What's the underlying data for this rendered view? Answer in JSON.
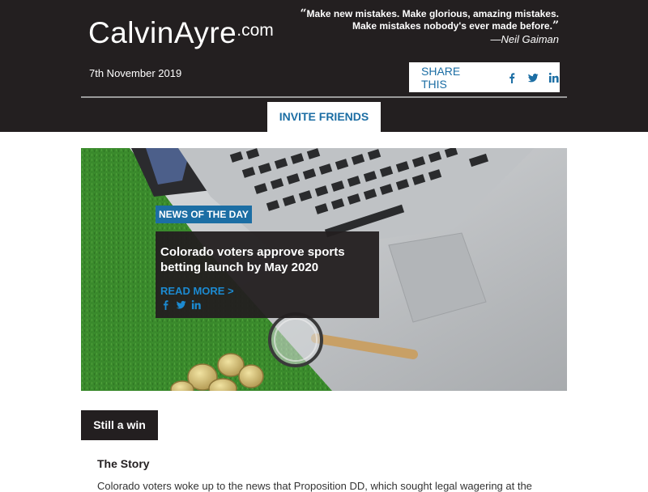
{
  "colors": {
    "header_bg": "#231f20",
    "accent_blue": "#1c6ea4",
    "link_blue": "#1c8ad0",
    "grass_green": "#3d8a2e"
  },
  "header": {
    "logo_name": "CalvinAyre",
    "logo_tld": ".com",
    "quote_open": "“",
    "quote_line1": "Make new mistakes. Make glorious, amazing mistakes.",
    "quote_line2": "Make mistakes nobody's ever made before.",
    "quote_close": "”",
    "quote_author": "—Neil Gaiman",
    "date": "7th November 2019",
    "share_label": "SHARE THIS",
    "share_icons": [
      "facebook-icon",
      "twitter-icon",
      "linkedin-icon"
    ],
    "invite_label": "INVITE FRIENDS"
  },
  "hero": {
    "tag": "NEWS OF THE DAY",
    "title": "Colorado voters approve sports betting launch by May 2020",
    "read_more": "READ MORE >",
    "social_icons": [
      "facebook-icon",
      "twitter-icon",
      "linkedin-icon"
    ]
  },
  "section": {
    "tag": "Still a win",
    "heading": "The Story",
    "body": "Colorado voters woke up to the news that Proposition DD, which sought legal wagering at the"
  }
}
